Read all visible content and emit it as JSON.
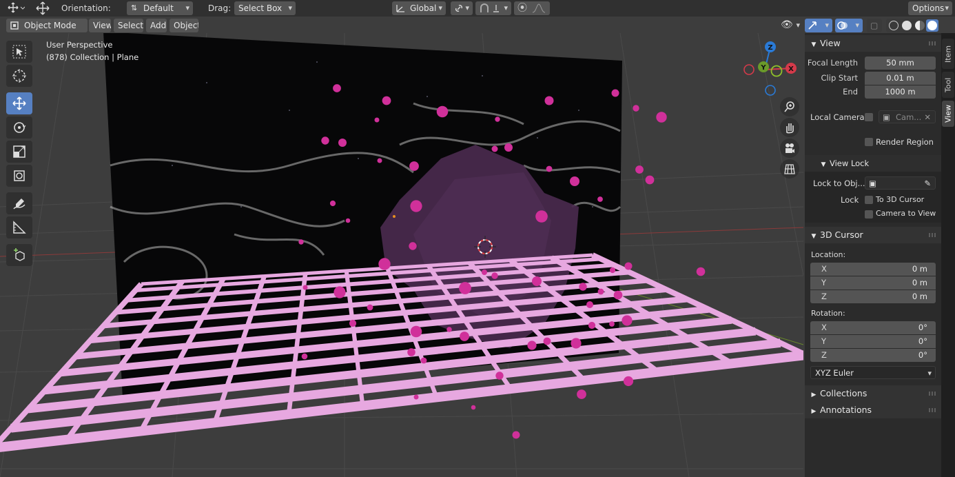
{
  "header": {
    "orientation_label": "Orientation:",
    "orientation_value": "Default",
    "drag_label": "Drag:",
    "drag_value": "Select Box",
    "transform_orientation": "Global",
    "options_label": "Options"
  },
  "viewport_header": {
    "mode": "Object Mode",
    "menus": [
      "View",
      "Select",
      "Add",
      "Object"
    ]
  },
  "overlay": {
    "perspective": "User Perspective",
    "collection": "(878) Collection | Plane"
  },
  "gizmo": {
    "z": "Z",
    "y": "Y",
    "x": "X"
  },
  "tabs": [
    "Item",
    "Tool",
    "View"
  ],
  "active_tab": "View",
  "view_panel": {
    "title": "View",
    "focal_length_label": "Focal Length",
    "focal_length": "50 mm",
    "clip_start_label": "Clip Start",
    "clip_start": "0.01 m",
    "clip_end_label": "End",
    "clip_end": "1000 m",
    "local_camera_label": "Local Camera",
    "local_camera_value": "Cam...",
    "render_region_label": "Render Region",
    "view_lock_title": "View Lock",
    "lock_to_object_label": "Lock to Obj...",
    "lock_label": "Lock",
    "to_3d_cursor_label": "To 3D Cursor",
    "camera_to_view_label": "Camera to View"
  },
  "cursor_panel": {
    "title": "3D Cursor",
    "location_label": "Location:",
    "location": [
      {
        "axis": "X",
        "value": "0 m"
      },
      {
        "axis": "Y",
        "value": "0 m"
      },
      {
        "axis": "Z",
        "value": "0 m"
      }
    ],
    "rotation_label": "Rotation:",
    "rotation": [
      {
        "axis": "X",
        "value": "0°"
      },
      {
        "axis": "Y",
        "value": "0°"
      },
      {
        "axis": "Z",
        "value": "0°"
      }
    ],
    "rotation_mode": "XYZ Euler"
  },
  "collapsed_panels": [
    "Collections",
    "Annotations"
  ],
  "colors": {
    "accent": "#5680c2",
    "grid_mesh": "#e7a8e0",
    "particles": "#d0309a",
    "blob": "#4a2a4e"
  }
}
